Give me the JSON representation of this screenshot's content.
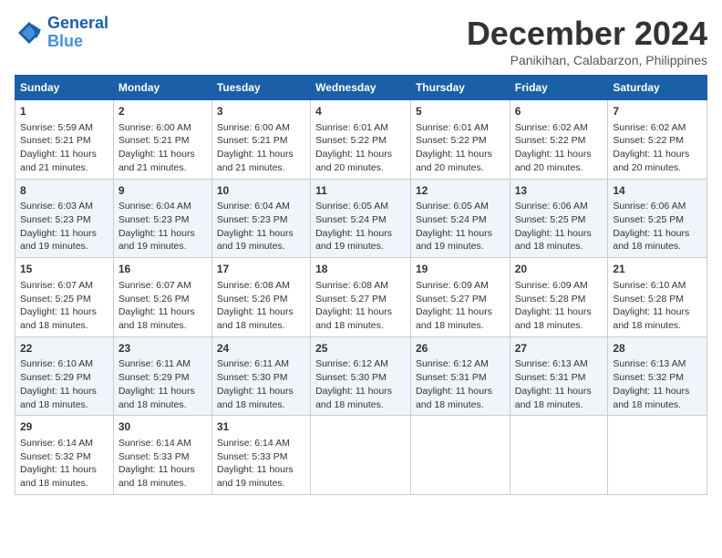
{
  "logo": {
    "line1": "General",
    "line2": "Blue"
  },
  "title": "December 2024",
  "location": "Panikihan, Calabarzon, Philippines",
  "days_of_week": [
    "Sunday",
    "Monday",
    "Tuesday",
    "Wednesday",
    "Thursday",
    "Friday",
    "Saturday"
  ],
  "weeks": [
    [
      {
        "day": "1",
        "sunrise": "Sunrise: 5:59 AM",
        "sunset": "Sunset: 5:21 PM",
        "daylight": "Daylight: 11 hours and 21 minutes."
      },
      {
        "day": "2",
        "sunrise": "Sunrise: 6:00 AM",
        "sunset": "Sunset: 5:21 PM",
        "daylight": "Daylight: 11 hours and 21 minutes."
      },
      {
        "day": "3",
        "sunrise": "Sunrise: 6:00 AM",
        "sunset": "Sunset: 5:21 PM",
        "daylight": "Daylight: 11 hours and 21 minutes."
      },
      {
        "day": "4",
        "sunrise": "Sunrise: 6:01 AM",
        "sunset": "Sunset: 5:22 PM",
        "daylight": "Daylight: 11 hours and 20 minutes."
      },
      {
        "day": "5",
        "sunrise": "Sunrise: 6:01 AM",
        "sunset": "Sunset: 5:22 PM",
        "daylight": "Daylight: 11 hours and 20 minutes."
      },
      {
        "day": "6",
        "sunrise": "Sunrise: 6:02 AM",
        "sunset": "Sunset: 5:22 PM",
        "daylight": "Daylight: 11 hours and 20 minutes."
      },
      {
        "day": "7",
        "sunrise": "Sunrise: 6:02 AM",
        "sunset": "Sunset: 5:22 PM",
        "daylight": "Daylight: 11 hours and 20 minutes."
      }
    ],
    [
      {
        "day": "8",
        "sunrise": "Sunrise: 6:03 AM",
        "sunset": "Sunset: 5:23 PM",
        "daylight": "Daylight: 11 hours and 19 minutes."
      },
      {
        "day": "9",
        "sunrise": "Sunrise: 6:04 AM",
        "sunset": "Sunset: 5:23 PM",
        "daylight": "Daylight: 11 hours and 19 minutes."
      },
      {
        "day": "10",
        "sunrise": "Sunrise: 6:04 AM",
        "sunset": "Sunset: 5:23 PM",
        "daylight": "Daylight: 11 hours and 19 minutes."
      },
      {
        "day": "11",
        "sunrise": "Sunrise: 6:05 AM",
        "sunset": "Sunset: 5:24 PM",
        "daylight": "Daylight: 11 hours and 19 minutes."
      },
      {
        "day": "12",
        "sunrise": "Sunrise: 6:05 AM",
        "sunset": "Sunset: 5:24 PM",
        "daylight": "Daylight: 11 hours and 19 minutes."
      },
      {
        "day": "13",
        "sunrise": "Sunrise: 6:06 AM",
        "sunset": "Sunset: 5:25 PM",
        "daylight": "Daylight: 11 hours and 18 minutes."
      },
      {
        "day": "14",
        "sunrise": "Sunrise: 6:06 AM",
        "sunset": "Sunset: 5:25 PM",
        "daylight": "Daylight: 11 hours and 18 minutes."
      }
    ],
    [
      {
        "day": "15",
        "sunrise": "Sunrise: 6:07 AM",
        "sunset": "Sunset: 5:25 PM",
        "daylight": "Daylight: 11 hours and 18 minutes."
      },
      {
        "day": "16",
        "sunrise": "Sunrise: 6:07 AM",
        "sunset": "Sunset: 5:26 PM",
        "daylight": "Daylight: 11 hours and 18 minutes."
      },
      {
        "day": "17",
        "sunrise": "Sunrise: 6:08 AM",
        "sunset": "Sunset: 5:26 PM",
        "daylight": "Daylight: 11 hours and 18 minutes."
      },
      {
        "day": "18",
        "sunrise": "Sunrise: 6:08 AM",
        "sunset": "Sunset: 5:27 PM",
        "daylight": "Daylight: 11 hours and 18 minutes."
      },
      {
        "day": "19",
        "sunrise": "Sunrise: 6:09 AM",
        "sunset": "Sunset: 5:27 PM",
        "daylight": "Daylight: 11 hours and 18 minutes."
      },
      {
        "day": "20",
        "sunrise": "Sunrise: 6:09 AM",
        "sunset": "Sunset: 5:28 PM",
        "daylight": "Daylight: 11 hours and 18 minutes."
      },
      {
        "day": "21",
        "sunrise": "Sunrise: 6:10 AM",
        "sunset": "Sunset: 5:28 PM",
        "daylight": "Daylight: 11 hours and 18 minutes."
      }
    ],
    [
      {
        "day": "22",
        "sunrise": "Sunrise: 6:10 AM",
        "sunset": "Sunset: 5:29 PM",
        "daylight": "Daylight: 11 hours and 18 minutes."
      },
      {
        "day": "23",
        "sunrise": "Sunrise: 6:11 AM",
        "sunset": "Sunset: 5:29 PM",
        "daylight": "Daylight: 11 hours and 18 minutes."
      },
      {
        "day": "24",
        "sunrise": "Sunrise: 6:11 AM",
        "sunset": "Sunset: 5:30 PM",
        "daylight": "Daylight: 11 hours and 18 minutes."
      },
      {
        "day": "25",
        "sunrise": "Sunrise: 6:12 AM",
        "sunset": "Sunset: 5:30 PM",
        "daylight": "Daylight: 11 hours and 18 minutes."
      },
      {
        "day": "26",
        "sunrise": "Sunrise: 6:12 AM",
        "sunset": "Sunset: 5:31 PM",
        "daylight": "Daylight: 11 hours and 18 minutes."
      },
      {
        "day": "27",
        "sunrise": "Sunrise: 6:13 AM",
        "sunset": "Sunset: 5:31 PM",
        "daylight": "Daylight: 11 hours and 18 minutes."
      },
      {
        "day": "28",
        "sunrise": "Sunrise: 6:13 AM",
        "sunset": "Sunset: 5:32 PM",
        "daylight": "Daylight: 11 hours and 18 minutes."
      }
    ],
    [
      {
        "day": "29",
        "sunrise": "Sunrise: 6:14 AM",
        "sunset": "Sunset: 5:32 PM",
        "daylight": "Daylight: 11 hours and 18 minutes."
      },
      {
        "day": "30",
        "sunrise": "Sunrise: 6:14 AM",
        "sunset": "Sunset: 5:33 PM",
        "daylight": "Daylight: 11 hours and 18 minutes."
      },
      {
        "day": "31",
        "sunrise": "Sunrise: 6:14 AM",
        "sunset": "Sunset: 5:33 PM",
        "daylight": "Daylight: 11 hours and 19 minutes."
      },
      null,
      null,
      null,
      null
    ]
  ]
}
